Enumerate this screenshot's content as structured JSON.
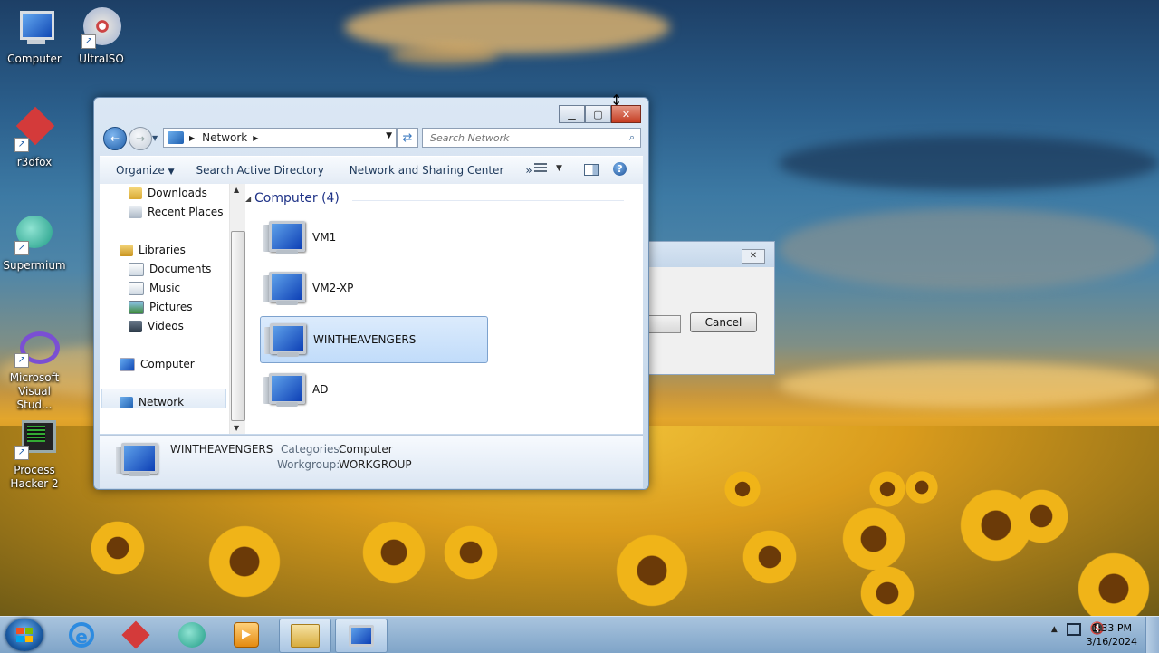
{
  "desktop": {
    "icons": [
      {
        "label": "Computer",
        "icon": "computer-icon"
      },
      {
        "label": "UltraISO",
        "icon": "disc-icon"
      },
      {
        "label": "r3dfox",
        "icon": "r3dfox-icon"
      },
      {
        "label": "Supermium",
        "icon": "supermium-icon"
      },
      {
        "label": "Microsoft Visual Stud...",
        "icon": "visual-studio-icon"
      },
      {
        "label": "Process Hacker 2",
        "icon": "process-hacker-icon"
      }
    ]
  },
  "explorer": {
    "address": {
      "crumb": "Network"
    },
    "search": {
      "placeholder": "Search Network"
    },
    "toolbar": {
      "organize": "Organize",
      "search_ad": "Search Active Directory",
      "network_sharing": "Network and Sharing Center",
      "more": "»"
    },
    "nav": {
      "downloads": "Downloads",
      "recent": "Recent Places",
      "libraries": "Libraries",
      "documents": "Documents",
      "music": "Music",
      "pictures": "Pictures",
      "videos": "Videos",
      "computer": "Computer",
      "network": "Network"
    },
    "group": {
      "header": "Computer (4)"
    },
    "computers": [
      "VM1",
      "VM2-XP",
      "WINTHEAVENGERS",
      "AD"
    ],
    "details": {
      "name": "WINTHEAVENGERS",
      "categories_label": "Categories:",
      "categories_value": "Computer",
      "workgroup_label": "Workgroup:",
      "workgroup_value": "WORKGROUP"
    }
  },
  "dialog": {
    "cancel": "Cancel"
  },
  "taskbar": {
    "time": "1:33 PM",
    "date": "3/16/2024"
  },
  "colors": {
    "accent": "#1e3287",
    "selection": "#c1dcfa"
  }
}
